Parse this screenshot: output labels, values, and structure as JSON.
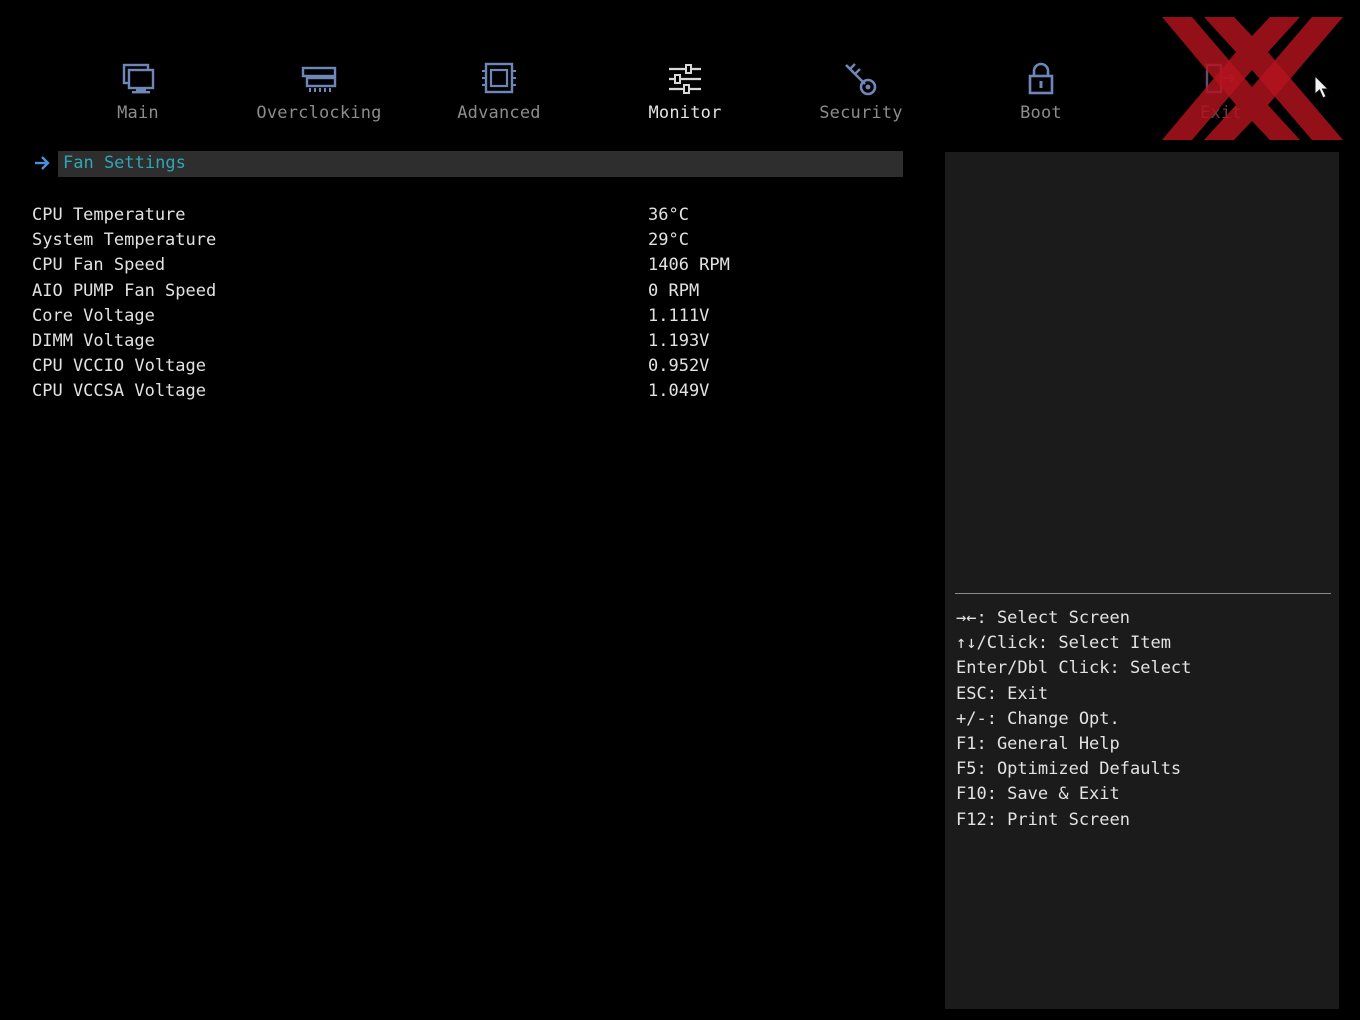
{
  "nav": {
    "tabs": [
      {
        "label": "Main",
        "icon": "monitor-computer-icon"
      },
      {
        "label": "Overclocking",
        "icon": "memory-module-icon"
      },
      {
        "label": "Advanced",
        "icon": "cpu-chip-icon"
      },
      {
        "label": "Monitor",
        "icon": "sliders-icon"
      },
      {
        "label": "Security",
        "icon": "key-icon"
      },
      {
        "label": "Boot",
        "icon": "lock-icon"
      },
      {
        "label": "Exit",
        "icon": "exit-door-icon"
      }
    ],
    "active": "Monitor"
  },
  "submenu": {
    "label": "Fan Settings"
  },
  "readings": [
    {
      "name": "CPU Temperature",
      "value": "36°C"
    },
    {
      "name": "System Temperature",
      "value": "29°C"
    },
    {
      "name": "CPU Fan Speed",
      "value": "1406 RPM"
    },
    {
      "name": "AIO PUMP Fan Speed",
      "value": "0 RPM"
    },
    {
      "name": "Core Voltage",
      "value": "1.111V"
    },
    {
      "name": "DIMM Voltage",
      "value": "1.193V"
    },
    {
      "name": "CPU VCCIO Voltage",
      "value": "0.952V"
    },
    {
      "name": "CPU VCCSA Voltage",
      "value": "1.049V"
    }
  ],
  "help": {
    "keys": [
      "→←: Select Screen",
      "↑↓/Click: Select Item",
      "Enter/Dbl Click: Select",
      "ESC: Exit",
      "+/-: Change Opt.",
      "F1: General Help",
      "F5: Optimized Defaults",
      "F10: Save & Exit",
      "F12: Print Screen"
    ]
  },
  "colors": {
    "background": "#000000",
    "panel": "#1b1b1b",
    "icon": "#6f87b8",
    "highlight_bar": "#2e2e2e",
    "highlight_text": "#2ea7b3",
    "watermark": "#b3141f"
  }
}
